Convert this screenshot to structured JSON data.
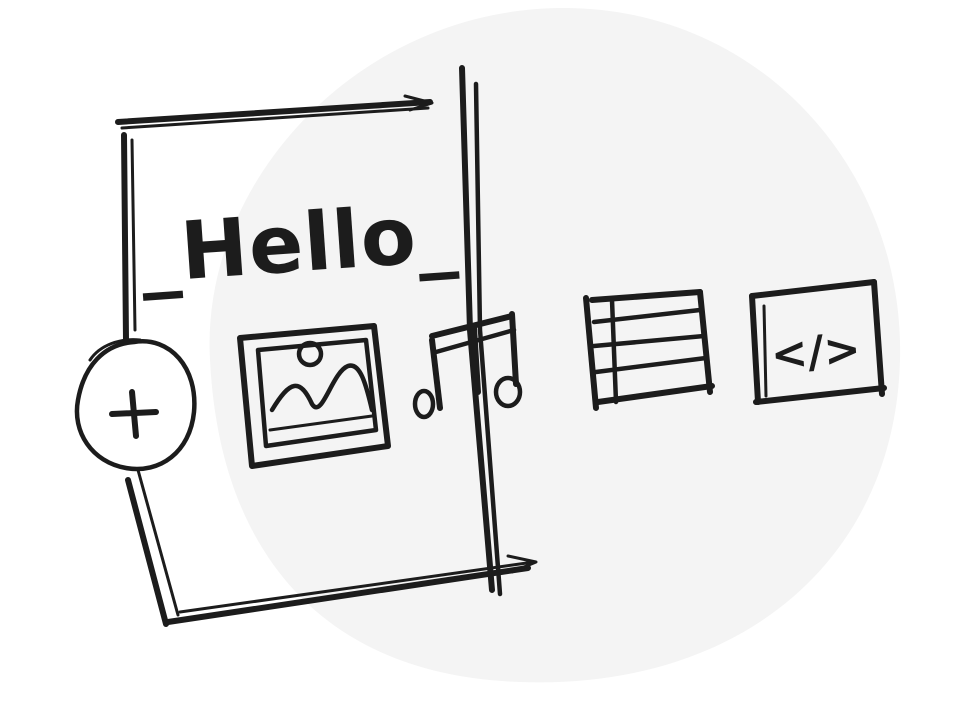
{
  "colors": {
    "ink": "#1c1c1c",
    "backdrop": "#f4f4f4",
    "page": "#ffffff"
  },
  "page": {
    "heading_text": "_Hello_"
  },
  "icons": {
    "add": "plus-circle-icon",
    "image": "image-icon",
    "music": "music-note-icon",
    "table": "table-icon",
    "code": "code-icon"
  },
  "code_icon_text": "</>"
}
